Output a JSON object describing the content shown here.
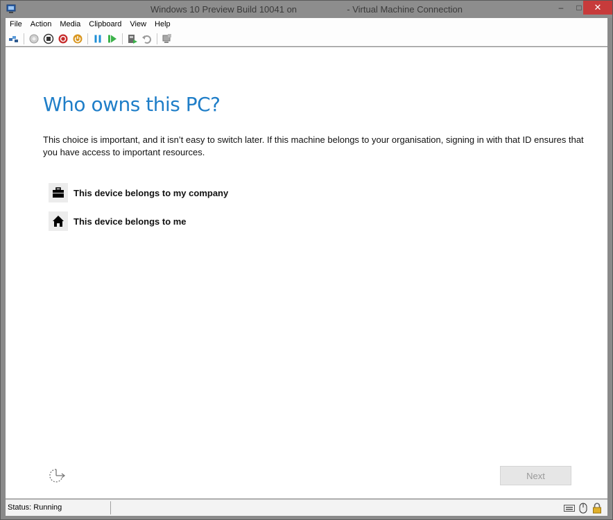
{
  "window": {
    "title": "Windows 10 Preview Build 10041 on                    - Virtual Machine Connection",
    "icon": "vm-connection-icon",
    "controls": {
      "minimize": "–",
      "maximize": "□",
      "close": "✕"
    }
  },
  "menu": {
    "items": [
      "File",
      "Action",
      "Media",
      "Clipboard",
      "View",
      "Help"
    ]
  },
  "toolbar": {
    "icons": [
      "ctrl-alt-del-icon",
      "start-icon",
      "turn-off-icon",
      "shutdown-icon",
      "save-icon",
      "pause-icon",
      "reset-icon",
      "checkpoint-icon",
      "revert-icon",
      "enhanced-session-icon"
    ]
  },
  "guest": {
    "heading": "Who owns this PC?",
    "description": "This choice is important, and it isn’t easy to switch later. If this machine belongs to your organisation, signing in with that ID ensures that you have access to important resources.",
    "options": [
      {
        "label": "This device belongs to my company",
        "icon": "briefcase-icon"
      },
      {
        "label": "This device belongs to me",
        "icon": "home-icon"
      }
    ],
    "next_label": "Next",
    "ease_of_access_icon": "ease-of-access-icon"
  },
  "status": {
    "text": "Status: Running",
    "icons": [
      "keyboard-icon",
      "mouse-icon",
      "lock-icon"
    ]
  },
  "colors": {
    "accent": "#1f7ec8",
    "close_button": "#c73b3b",
    "title_bar": "#8d8d8d"
  }
}
